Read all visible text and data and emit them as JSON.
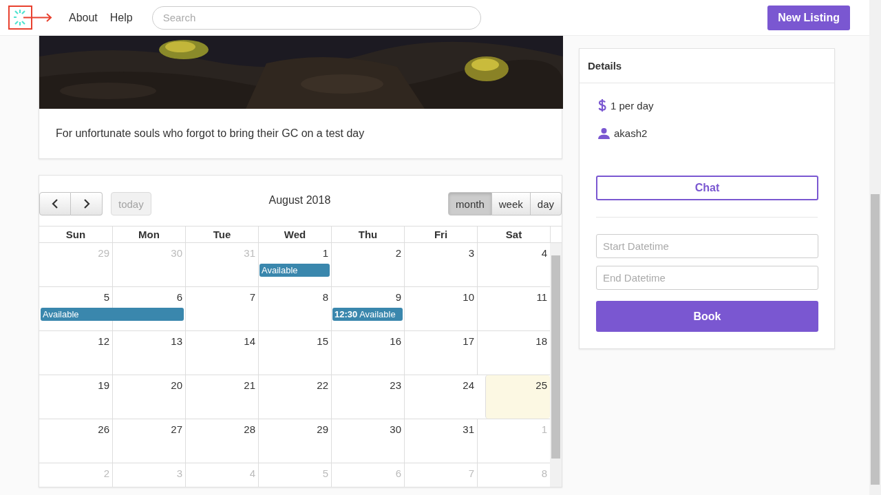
{
  "nav": {
    "links": [
      {
        "label": "About"
      },
      {
        "label": "Help"
      }
    ],
    "search": {
      "placeholder": "Search"
    },
    "new_listing": "New Listing"
  },
  "listing": {
    "description": "For unfortunate souls who forgot to bring their GC on a test day"
  },
  "calendar": {
    "title": "August 2018",
    "today_button": {
      "label": "today",
      "disabled": true
    },
    "views": [
      {
        "label": "month",
        "selected": true
      },
      {
        "label": "week",
        "selected": false
      },
      {
        "label": "day",
        "selected": false
      }
    ],
    "weekdays": [
      "Sun",
      "Mon",
      "Tue",
      "Wed",
      "Thu",
      "Fri",
      "Sat"
    ],
    "weeks": [
      {
        "days": [
          {
            "label": "29",
            "other_month": true,
            "today": false
          },
          {
            "label": "30",
            "other_month": true,
            "today": false
          },
          {
            "label": "31",
            "other_month": true,
            "today": false
          },
          {
            "label": "1",
            "other_month": false,
            "today": false,
            "event": {
              "title": "Available"
            }
          },
          {
            "label": "2",
            "other_month": false,
            "today": false
          },
          {
            "label": "3",
            "other_month": false,
            "today": false
          },
          {
            "label": "4",
            "other_month": false,
            "today": false
          }
        ]
      },
      {
        "days": [
          {
            "label": "5",
            "other_month": false,
            "today": false,
            "event": {
              "title": "Available"
            }
          },
          {
            "label": "6",
            "other_month": false,
            "today": false,
            "continued": true
          },
          {
            "label": "7",
            "other_month": false,
            "today": false
          },
          {
            "label": "8",
            "other_month": false,
            "today": false
          },
          {
            "label": "9",
            "other_month": false,
            "today": false,
            "event": {
              "title": "**12:30** Available"
            }
          },
          {
            "label": "10",
            "other_month": false,
            "today": false
          },
          {
            "label": "11",
            "other_month": false,
            "today": false
          }
        ]
      },
      {
        "days": [
          {
            "label": "12",
            "other_month": false,
            "today": false
          },
          {
            "label": "13",
            "other_month": false,
            "today": false
          },
          {
            "label": "14",
            "other_month": false,
            "today": false
          },
          {
            "label": "15",
            "other_month": false,
            "today": false
          },
          {
            "label": "16",
            "other_month": false,
            "today": false
          },
          {
            "label": "17",
            "other_month": false,
            "today": false
          },
          {
            "label": "18",
            "other_month": false,
            "today": false
          }
        ]
      },
      {
        "days": [
          {
            "label": "19",
            "other_month": false,
            "today": false
          },
          {
            "label": "20",
            "other_month": false,
            "today": false
          },
          {
            "label": "21",
            "other_month": false,
            "today": false
          },
          {
            "label": "22",
            "other_month": false,
            "today": false
          },
          {
            "label": "23",
            "other_month": false,
            "today": false
          },
          {
            "label": "24",
            "other_month": false,
            "today": false
          },
          {
            "label": "25",
            "other_month": false,
            "today": true
          }
        ]
      },
      {
        "days": [
          {
            "label": "26",
            "other_month": false,
            "today": false
          },
          {
            "label": "27",
            "other_month": false,
            "today": false
          },
          {
            "label": "28",
            "other_month": false,
            "today": false
          },
          {
            "label": "29",
            "other_month": false,
            "today": false
          },
          {
            "label": "30",
            "other_month": false,
            "today": false
          },
          {
            "label": "31",
            "other_month": false,
            "today": false
          },
          {
            "label": "1",
            "other_month": true,
            "today": false
          }
        ]
      },
      {
        "days": [
          {
            "label": "2",
            "other_month": true,
            "today": false
          },
          {
            "label": "3",
            "other_month": true,
            "today": false
          },
          {
            "label": "4",
            "other_month": true,
            "today": false
          },
          {
            "label": "5",
            "other_month": true,
            "today": false
          },
          {
            "label": "6",
            "other_month": true,
            "today": false
          },
          {
            "label": "7",
            "other_month": true,
            "today": false
          },
          {
            "label": "8",
            "other_month": true,
            "today": false
          }
        ]
      }
    ]
  },
  "details": {
    "title": "Details",
    "price": "1 per day",
    "owner": "akash2",
    "chat_button": "Chat",
    "start_field": {
      "placeholder": "Start Datetime"
    },
    "end_field": {
      "placeholder": "End Datetime"
    },
    "book_button": "Book"
  }
}
